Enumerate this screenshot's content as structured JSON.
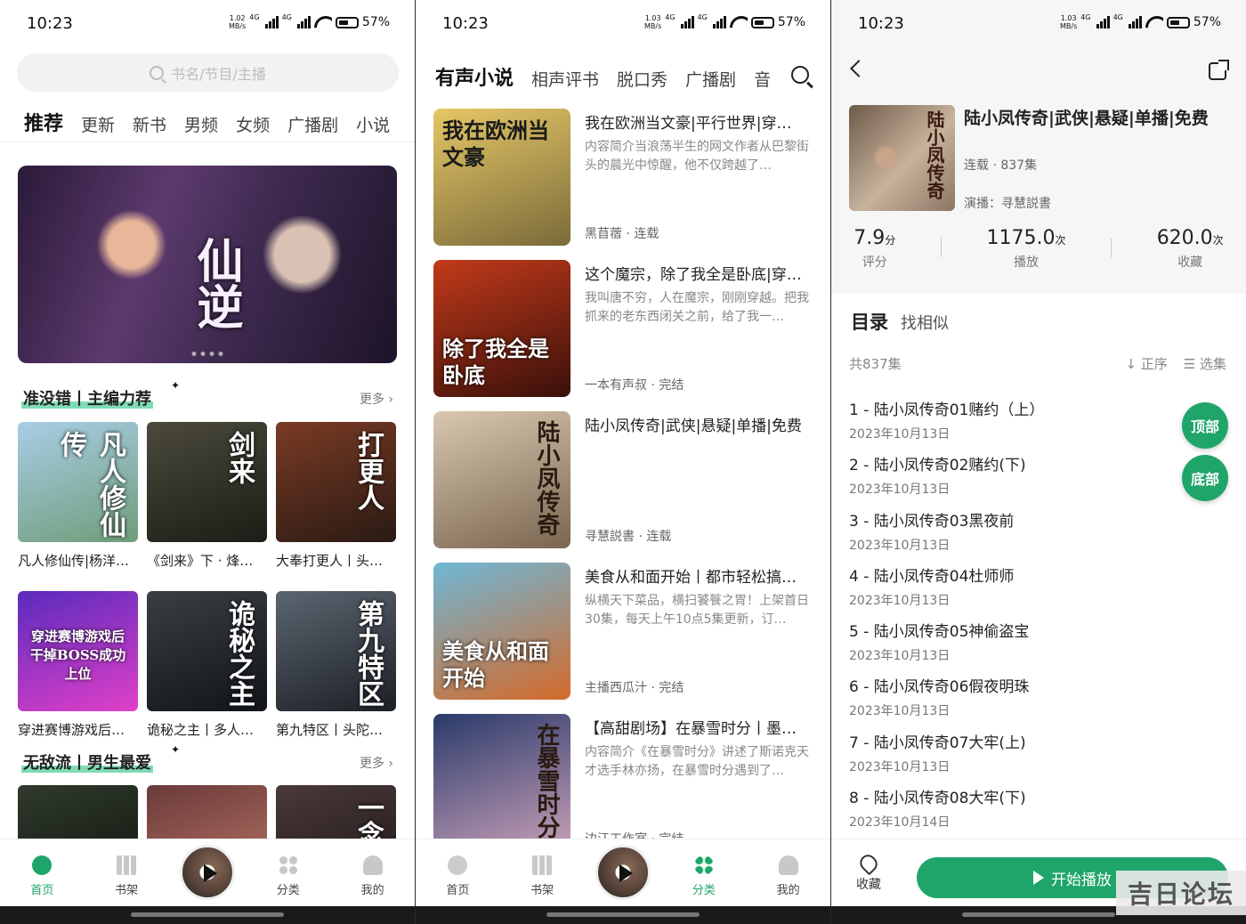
{
  "status_bar": {
    "time": "10:23",
    "speed_p1": "1.02\nMB/s",
    "speed": "1.03\nMB/s",
    "net": "4G",
    "battery": "57%"
  },
  "home": {
    "search_placeholder": "书名/节目/主播",
    "tabs": [
      "推荐",
      "更新",
      "新书",
      "男频",
      "女频",
      "广播剧",
      "小说"
    ],
    "banner_title": "仙逆",
    "sections": [
      {
        "title": "准没错丨主编力荐",
        "more": "更多 ›",
        "items": [
          {
            "title": "凡人修仙传|杨洋…",
            "cover_text": "凡人修仙传",
            "colors": [
              "#a9cde6",
              "#6f9d7a"
            ]
          },
          {
            "title": "《剑来》下 · 烽…",
            "cover_text": "剑来",
            "colors": [
              "#4b4a3c",
              "#1d1c16"
            ]
          },
          {
            "title": "大奉打更人丨头…",
            "cover_text": "打更人",
            "colors": [
              "#7a3b24",
              "#2a1a14"
            ]
          },
          {
            "title": "穿进赛博游戏后…",
            "cover_text": "穿进赛博游戏后干掉BOSS成功上位",
            "colors": [
              "#5a2bbd",
              "#e040c8"
            ]
          },
          {
            "title": "诡秘之主丨多人…",
            "cover_text": "诡秘之主",
            "colors": [
              "#3a3f44",
              "#111418"
            ]
          },
          {
            "title": "第九特区丨头陀…",
            "cover_text": "第九特区",
            "colors": [
              "#5b6570",
              "#1d2026"
            ]
          }
        ]
      },
      {
        "title": "无敌流丨男生最爱",
        "more": "更多 ›",
        "items": [
          {
            "title": "",
            "cover_text": "",
            "colors": [
              "#2f3a2c",
              "#0e120d"
            ]
          },
          {
            "title": "",
            "cover_text": "",
            "colors": [
              "#6a3a3a",
              "#c27b6a"
            ]
          },
          {
            "title": "",
            "cover_text": "一念永恒",
            "colors": [
              "#4a3a3a",
              "#1a1212"
            ]
          }
        ]
      }
    ]
  },
  "nav": {
    "p1": [
      {
        "label": "首页",
        "icon": "home-icon",
        "active": true
      },
      {
        "label": "书架",
        "icon": "shelf-icon"
      },
      {
        "label": "",
        "icon": "player-icon"
      },
      {
        "label": "分类",
        "icon": "category-icon"
      },
      {
        "label": "我的",
        "icon": "user-icon"
      }
    ],
    "p2": [
      {
        "label": "首页",
        "icon": "home-icon"
      },
      {
        "label": "书架",
        "icon": "shelf-icon"
      },
      {
        "label": "",
        "icon": "player-icon"
      },
      {
        "label": "分类",
        "icon": "category-icon",
        "active": true
      },
      {
        "label": "我的",
        "icon": "user-icon"
      }
    ]
  },
  "category": {
    "tabs": [
      "有声小说",
      "相声评书",
      "脱口秀",
      "广播剧",
      "音"
    ],
    "items": [
      {
        "title": "我在欧洲当文豪|平行世界|穿…",
        "desc": "内容简介当浪荡半生的网文作者从巴黎街头的晨光中惊醒，他不仅跨越了…",
        "author": "黑苜蓿",
        "status": "连载",
        "cover_text": "我在欧洲当文豪",
        "colors": [
          "#e6c766",
          "#7a6b3a"
        ]
      },
      {
        "title": "这个魔宗，除了我全是卧底|穿…",
        "desc": "我叫唐不穷，人在魔宗，刚刚穿越。把我抓来的老东西闭关之前，给了我一…",
        "author": "一本有声叔",
        "status": "完结",
        "cover_text": "除了我全是卧底",
        "colors": [
          "#c23a1a",
          "#3a100a"
        ]
      },
      {
        "title": "陆小凤传奇|武侠|悬疑|单播|免费",
        "desc": "",
        "author": "寻慧説書",
        "status": "连载",
        "cover_text": "陆小凤传奇",
        "colors": [
          "#d9c7b0",
          "#7a6650"
        ]
      },
      {
        "title": "美食从和面开始丨都市轻松搞…",
        "desc": "纵横天下菜品，横扫饕餮之胃！上架首日30集，每天上午10点5集更新，订…",
        "author": "主播西瓜汁",
        "status": "完结",
        "cover_text": "美食从和面开始",
        "colors": [
          "#6fb7d6",
          "#d46a2a"
        ]
      },
      {
        "title": "【高甜剧场】在暴雪时分丨墨…",
        "desc": "内容简介《在暴雪时分》讲述了斯诺克天才选手林亦扬，在暴雪时分遇到了…",
        "author": "边江工作室",
        "status": "完结",
        "cover_text": "在暴雪时分",
        "colors": [
          "#2a3a6a",
          "#c8a0b8"
        ]
      }
    ]
  },
  "detail": {
    "title": "陆小凤传奇|武侠|悬疑|单播|免费",
    "cover_text": "陆小凤传奇",
    "status": "连载 · 837集",
    "narrator": "演播：寻慧説書",
    "stats": [
      {
        "value": "7.9",
        "unit": "分",
        "label": "评分"
      },
      {
        "value": "1175.0",
        "unit": "次",
        "label": "播放"
      },
      {
        "value": "620.0",
        "unit": "次",
        "label": "收藏"
      }
    ],
    "catalog_tab": "目录",
    "similar_tab": "找相似",
    "count": "共837集",
    "sort_label": "↓ 正序",
    "select_label": "☰ 选集",
    "episodes": [
      {
        "title": "1 - 陆小凤传奇01赌约（上）",
        "date": "2023年10月13日"
      },
      {
        "title": "2 - 陆小凤传奇02赌约(下)",
        "date": "2023年10月13日"
      },
      {
        "title": "3 - 陆小凤传奇03黑夜前",
        "date": "2023年10月13日"
      },
      {
        "title": "4 - 陆小凤传奇04杜师师",
        "date": "2023年10月13日"
      },
      {
        "title": "5 - 陆小凤传奇05神偷盗宝",
        "date": "2023年10月13日"
      },
      {
        "title": "6 - 陆小凤传奇06假夜明珠",
        "date": "2023年10月13日"
      },
      {
        "title": "7 - 陆小凤传奇07大牢(上)",
        "date": "2023年10月13日"
      },
      {
        "title": "8 - 陆小凤传奇08大牢(下)",
        "date": "2023年10月14日"
      }
    ],
    "top_btn": "顶部",
    "bottom_btn": "底部",
    "fav_label": "收藏",
    "play_label": "开始播放",
    "watermark": "吉日论坛",
    "accent": "#1fa56a"
  }
}
